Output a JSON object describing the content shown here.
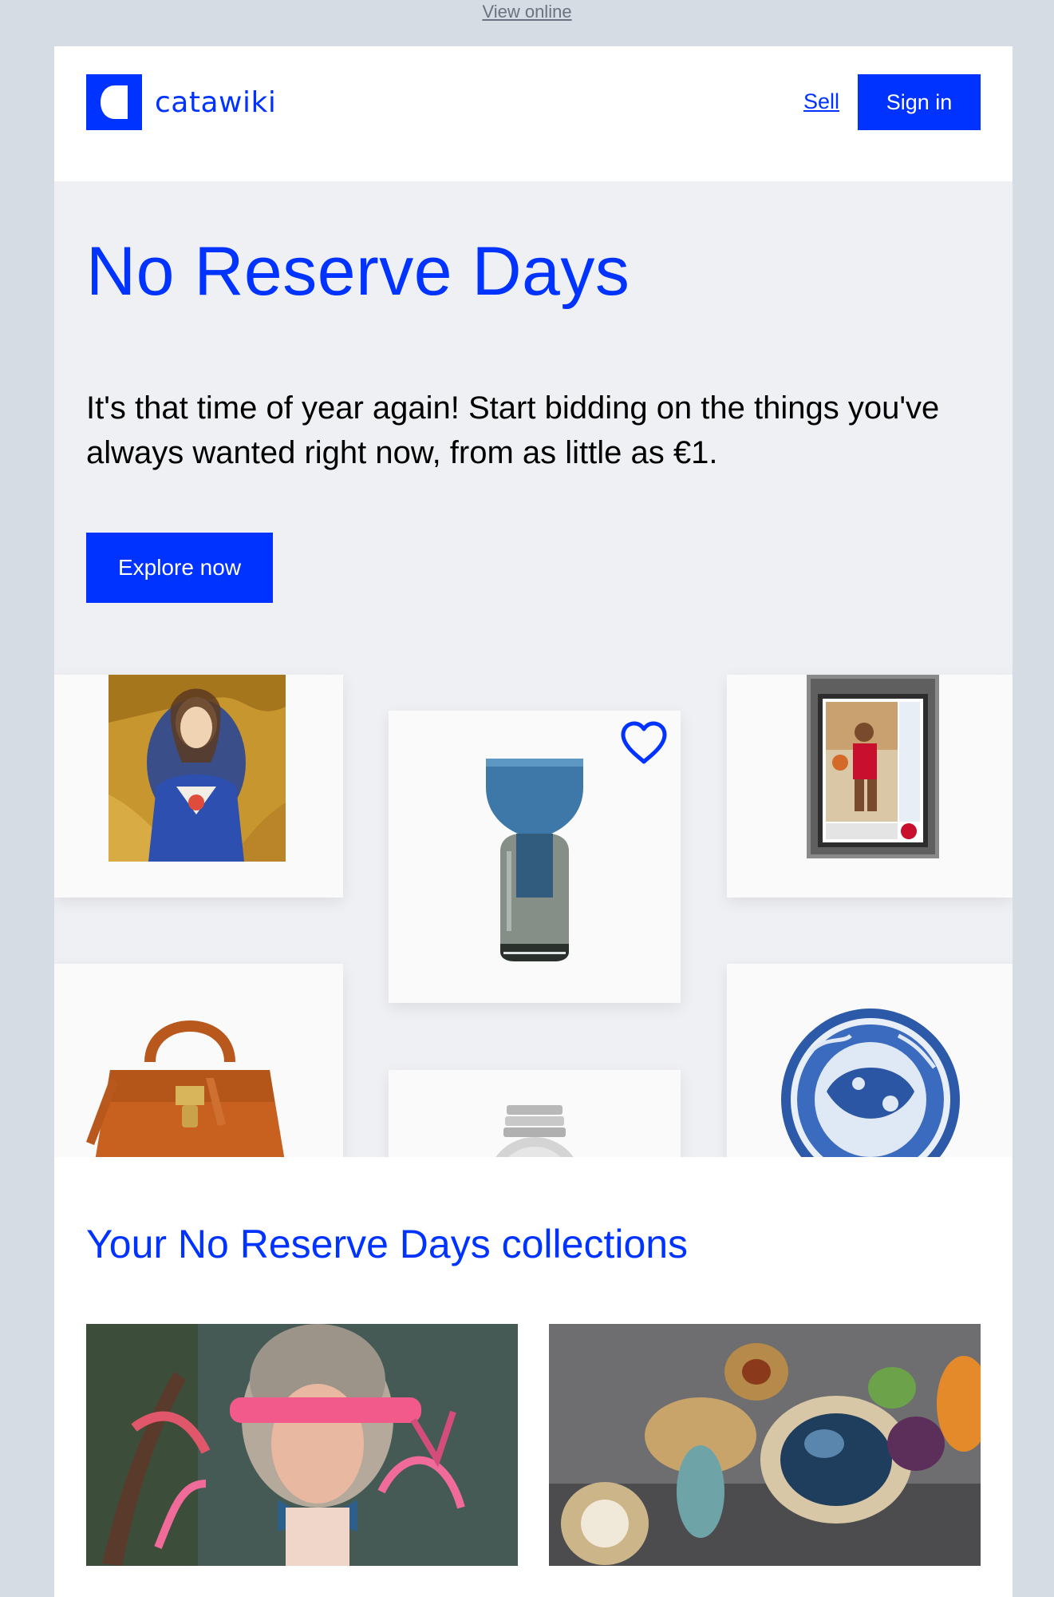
{
  "top_bar": {
    "view_online_label": "View online"
  },
  "header": {
    "brand_name": "catawiki",
    "sell_label": "Sell",
    "signin_label": "Sign in"
  },
  "hero": {
    "title": "No Reserve Days",
    "body": "It's that time of year again! Start bidding on the things you've always wanted right now, from as little as €1.",
    "cta_label": "Explore now"
  },
  "collections": {
    "title": "Your No Reserve Days collections"
  },
  "colors": {
    "brand_blue": "#0033ff",
    "page_bg": "#d5dce3",
    "hero_bg": "#eff0f3"
  },
  "icons": [
    "catawiki-logo-icon",
    "heart-icon"
  ]
}
